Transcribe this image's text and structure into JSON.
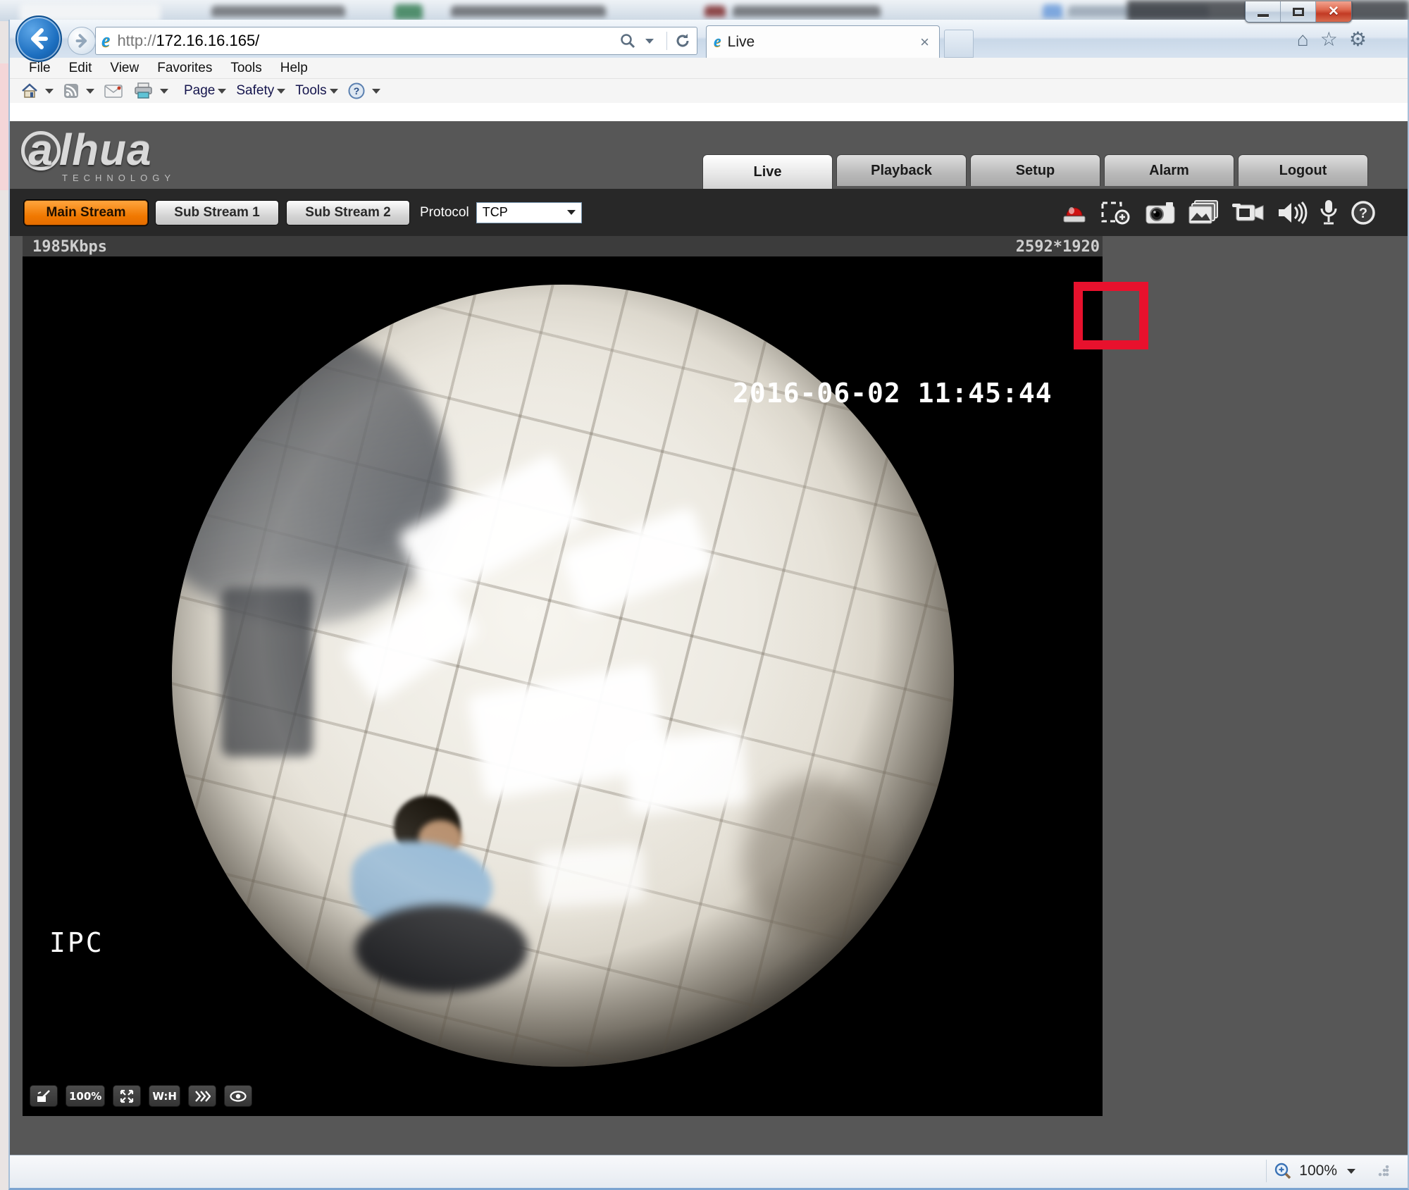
{
  "browser": {
    "address": {
      "scheme": "http://",
      "host": "172.16.16.165/"
    },
    "tab": {
      "title": "Live"
    },
    "menu_items": [
      "File",
      "Edit",
      "View",
      "Favorites",
      "Tools",
      "Help"
    ],
    "command_bar": {
      "page_label": "Page",
      "safety_label": "Safety",
      "tools_label": "Tools"
    },
    "status_bar": {
      "zoom_level": "100%"
    }
  },
  "camera_ui": {
    "brand": {
      "logo_text": "lhua",
      "logo_first_letter": "a",
      "logo_sub": "TECHNOLOGY"
    },
    "nav_tabs": [
      {
        "label": "Live",
        "active": true
      },
      {
        "label": "Playback",
        "active": false
      },
      {
        "label": "Setup",
        "active": false
      },
      {
        "label": "Alarm",
        "active": false
      },
      {
        "label": "Logout",
        "active": false
      }
    ],
    "streams": [
      {
        "label": "Main Stream",
        "active": true
      },
      {
        "label": "Sub Stream 1",
        "active": false
      },
      {
        "label": "Sub Stream 2",
        "active": false
      }
    ],
    "protocol": {
      "label": "Protocol",
      "value": "TCP"
    },
    "live_toolbar_icons": [
      "relay-out-alarm",
      "digital-zoom",
      "snapshot",
      "triple-snapshot",
      "record",
      "audio",
      "talk",
      "help"
    ],
    "highlight_color": "#e8112d",
    "video_overlay": {
      "bitrate": "1985Kbps",
      "resolution": "2592*1920",
      "timestamp": "2016-06-02 11:45:44",
      "label": "IPC"
    },
    "video_controls": {
      "zoom_value": "100%",
      "aspect_label": "W:H"
    },
    "colors": {
      "accent_orange": "#f07800",
      "highlight_red": "#e8112d",
      "page_bg": "#575757",
      "toolbar_bg": "#282828",
      "video_bg": "#000000"
    }
  }
}
